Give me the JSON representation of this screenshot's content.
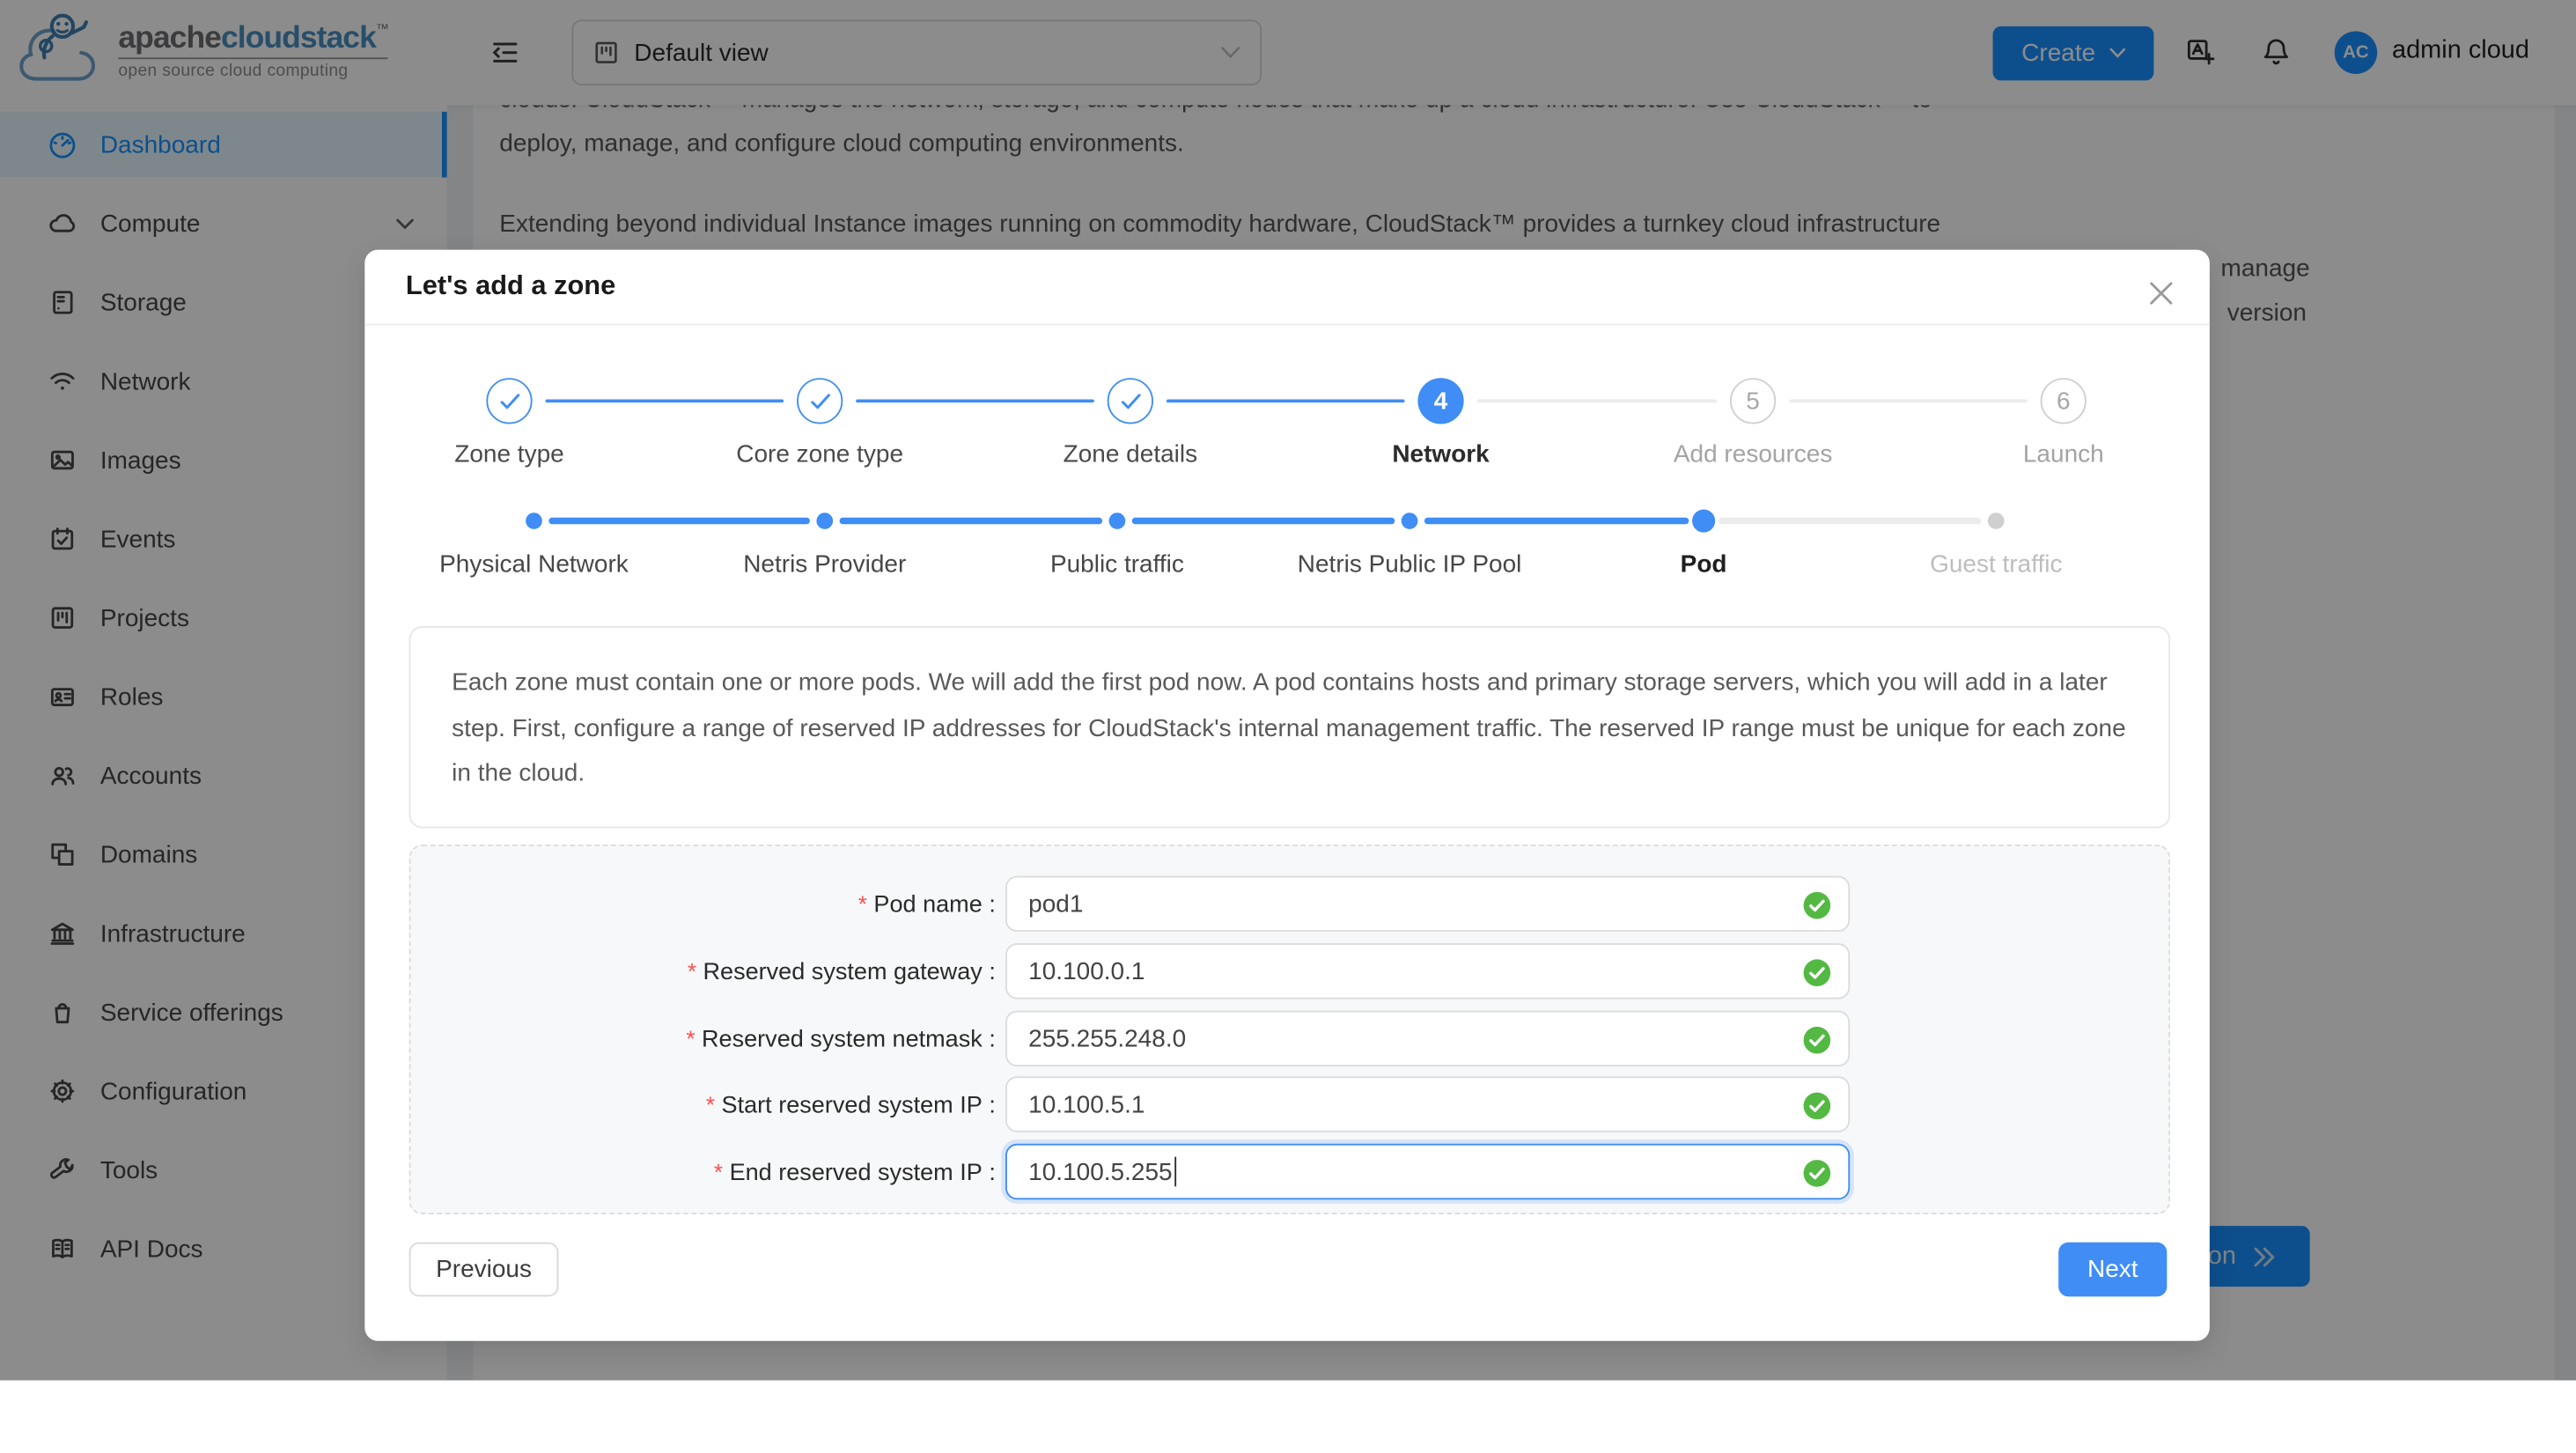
{
  "colors": {
    "app_primary": "#1890ff",
    "modal_primary": "#3f8df5",
    "valid_green": "#53b942",
    "required_red": "#ff4d4f",
    "mask": "rgba(0,0,0,0.45)",
    "menu_selected_bg": "#e6f7ff"
  },
  "logo": {
    "brand_gray": "apache",
    "brand_blue": "cloudstack",
    "trademark": "™",
    "tagline": "open source cloud computing",
    "icon": "cloudstack-monkey-cloud-logo"
  },
  "topbar": {
    "view_select": {
      "value": "Default view",
      "icon": "project-icon",
      "chevron": "chevron-down-icon"
    },
    "create_label": "Create",
    "icons": [
      "menu-fold-icon",
      "translate-icon",
      "bell-icon"
    ],
    "user": {
      "initials": "AC",
      "name": "admin cloud"
    }
  },
  "sidebar": {
    "items": [
      {
        "label": "Dashboard",
        "icon": "dashboard-icon",
        "active": true
      },
      {
        "label": "Compute",
        "icon": "cloud-icon",
        "has_chevron": true
      },
      {
        "label": "Storage",
        "icon": "storage-icon"
      },
      {
        "label": "Network",
        "icon": "wifi-icon"
      },
      {
        "label": "Images",
        "icon": "picture-icon"
      },
      {
        "label": "Events",
        "icon": "calendar-check-icon"
      },
      {
        "label": "Projects",
        "icon": "kanban-icon"
      },
      {
        "label": "Roles",
        "icon": "id-card-icon"
      },
      {
        "label": "Accounts",
        "icon": "team-icon"
      },
      {
        "label": "Domains",
        "icon": "overlapping-squares-icon"
      },
      {
        "label": "Infrastructure",
        "icon": "bank-icon"
      },
      {
        "label": "Service offerings",
        "icon": "shopping-bag-icon"
      },
      {
        "label": "Configuration",
        "icon": "gear-icon"
      },
      {
        "label": "Tools",
        "icon": "wrench-icon"
      },
      {
        "label": "API Docs",
        "icon": "open-book-icon"
      }
    ]
  },
  "background_page": {
    "para1_line1": "clouds. CloudStack™ manages the network, storage, and compute nodes that make up a cloud infrastructure. Use CloudStack™ to",
    "para1_line2": "deploy, manage, and configure cloud computing environments.",
    "para2_line1": "Extending beyond individual Instance images running on commodity hardware, CloudStack™ provides a turnkey cloud infrastructure",
    "fragment_line2_end": "manage",
    "fragment_line3_end": "version",
    "doc_button_label": "Documentation",
    "doc_button_icon": "double-chevron-right-icon"
  },
  "modal": {
    "title": "Let's add a zone",
    "close_icon": "close-icon",
    "steps": [
      {
        "label": "Zone type",
        "state": "finish"
      },
      {
        "label": "Core zone type",
        "state": "finish"
      },
      {
        "label": "Zone details",
        "state": "finish"
      },
      {
        "label": "Network",
        "state": "active",
        "number": "4"
      },
      {
        "label": "Add resources",
        "state": "wait",
        "number": "5"
      },
      {
        "label": "Launch",
        "state": "wait",
        "number": "6"
      }
    ],
    "sub_steps": [
      {
        "label": "Physical Network"
      },
      {
        "label": "Netris Provider"
      },
      {
        "label": "Public traffic"
      },
      {
        "label": "Netris Public IP Pool"
      },
      {
        "label": "Pod",
        "active": true
      },
      {
        "label": "Guest traffic",
        "pending": true
      }
    ],
    "info": "Each zone must contain one or more pods. We will add the first pod now. A pod contains hosts and primary storage servers, which you will add in a later step. First, configure a range of reserved IP addresses for CloudStack's internal management traffic. The reserved IP range must be unique for each zone in the cloud.",
    "form": {
      "required_mark": "*",
      "colon": ":",
      "fields": [
        {
          "label": "Pod name",
          "value": "pod1",
          "valid": true
        },
        {
          "label": "Reserved system gateway",
          "value": "10.100.0.1",
          "valid": true
        },
        {
          "label": "Reserved system netmask",
          "value": "255.255.248.0",
          "valid": true
        },
        {
          "label": "Start reserved system IP",
          "value": "10.100.5.1",
          "valid": true
        },
        {
          "label": "End reserved system IP",
          "value": "10.100.5.255",
          "valid": true,
          "focused": true
        }
      ]
    },
    "buttons": {
      "previous": "Previous",
      "next": "Next"
    }
  }
}
